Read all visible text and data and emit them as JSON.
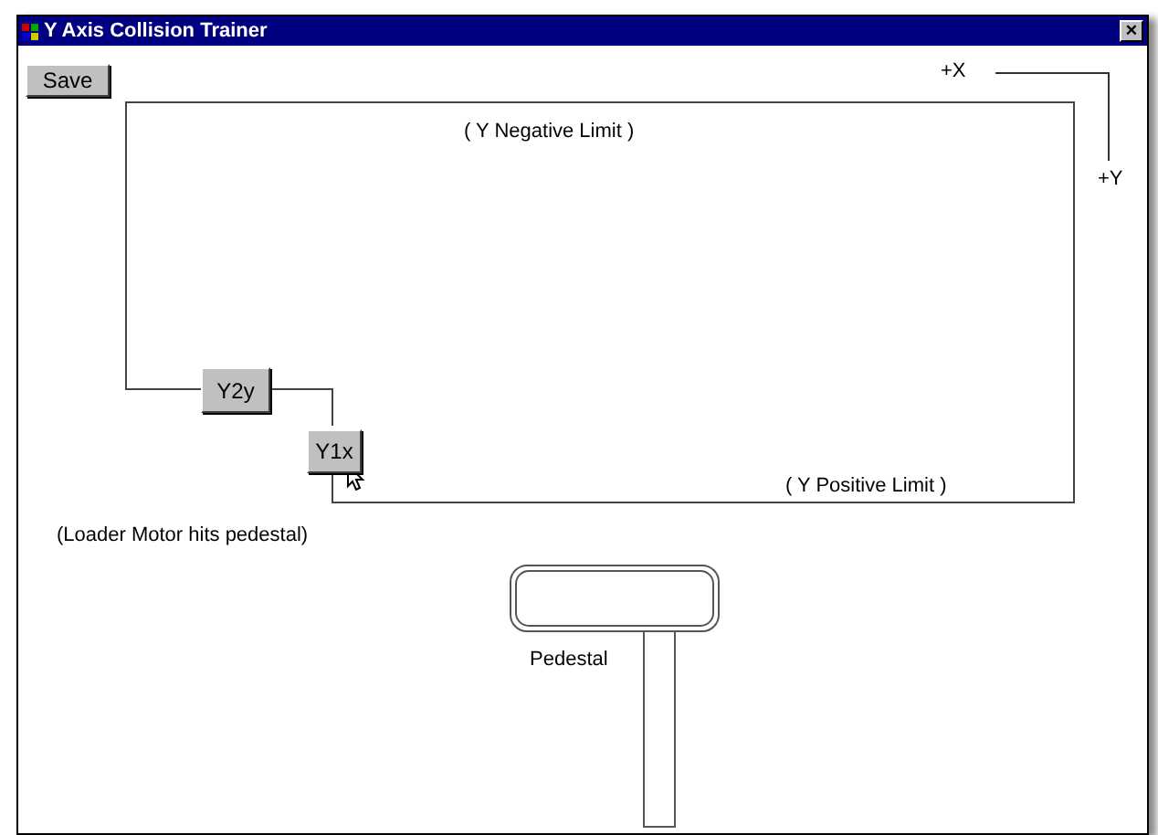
{
  "window": {
    "title": "Y Axis Collision Trainer",
    "close": "×"
  },
  "toolbar": {
    "save": "Save"
  },
  "axes": {
    "x_label": "+X",
    "y_label": "+Y"
  },
  "travel_area": {
    "negative_limit": "( Y Negative Limit )",
    "positive_limit": "( Y Positive Limit )"
  },
  "axis_buttons": [
    {
      "label": "Y2y"
    },
    {
      "label": "Y1x"
    }
  ],
  "caption": "(Loader Motor hits pedestal)",
  "pedestal": {
    "label": "Pedestal"
  }
}
